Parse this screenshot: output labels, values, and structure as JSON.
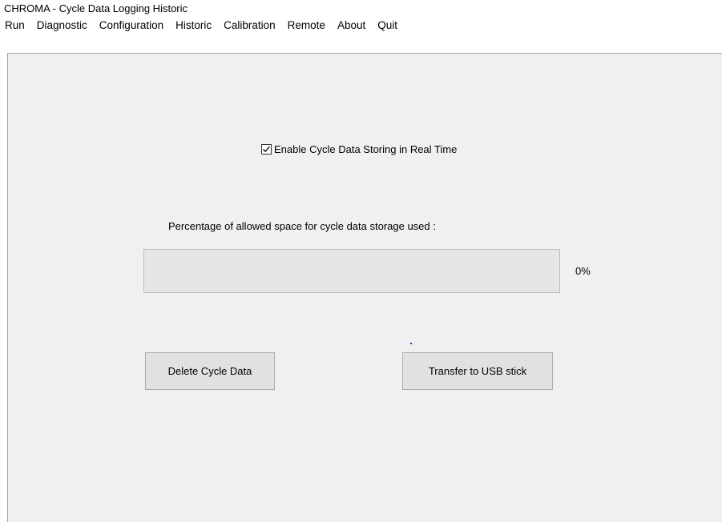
{
  "window": {
    "title": "CHROMA - Cycle Data Logging Historic"
  },
  "menu": {
    "items": [
      "Run",
      "Diagnostic",
      "Configuration",
      "Historic",
      "Calibration",
      "Remote",
      "About",
      "Quit"
    ]
  },
  "cycle_data": {
    "enable_checkbox": {
      "label": "Enable Cycle Data Storing in Real Time",
      "checked": true
    },
    "storage": {
      "caption": "Percentage of allowed space for cycle data storage used :",
      "percent_text": "0%",
      "percent_value": 0
    },
    "buttons": {
      "delete_label": "Delete Cycle Data",
      "transfer_label": "Transfer to USB stick"
    }
  },
  "colors": {
    "panel_background": "#f0f0f0",
    "button_background": "#e1e1e1",
    "progress_track": "#e6e6e6",
    "progress_fill": "#06b025"
  }
}
